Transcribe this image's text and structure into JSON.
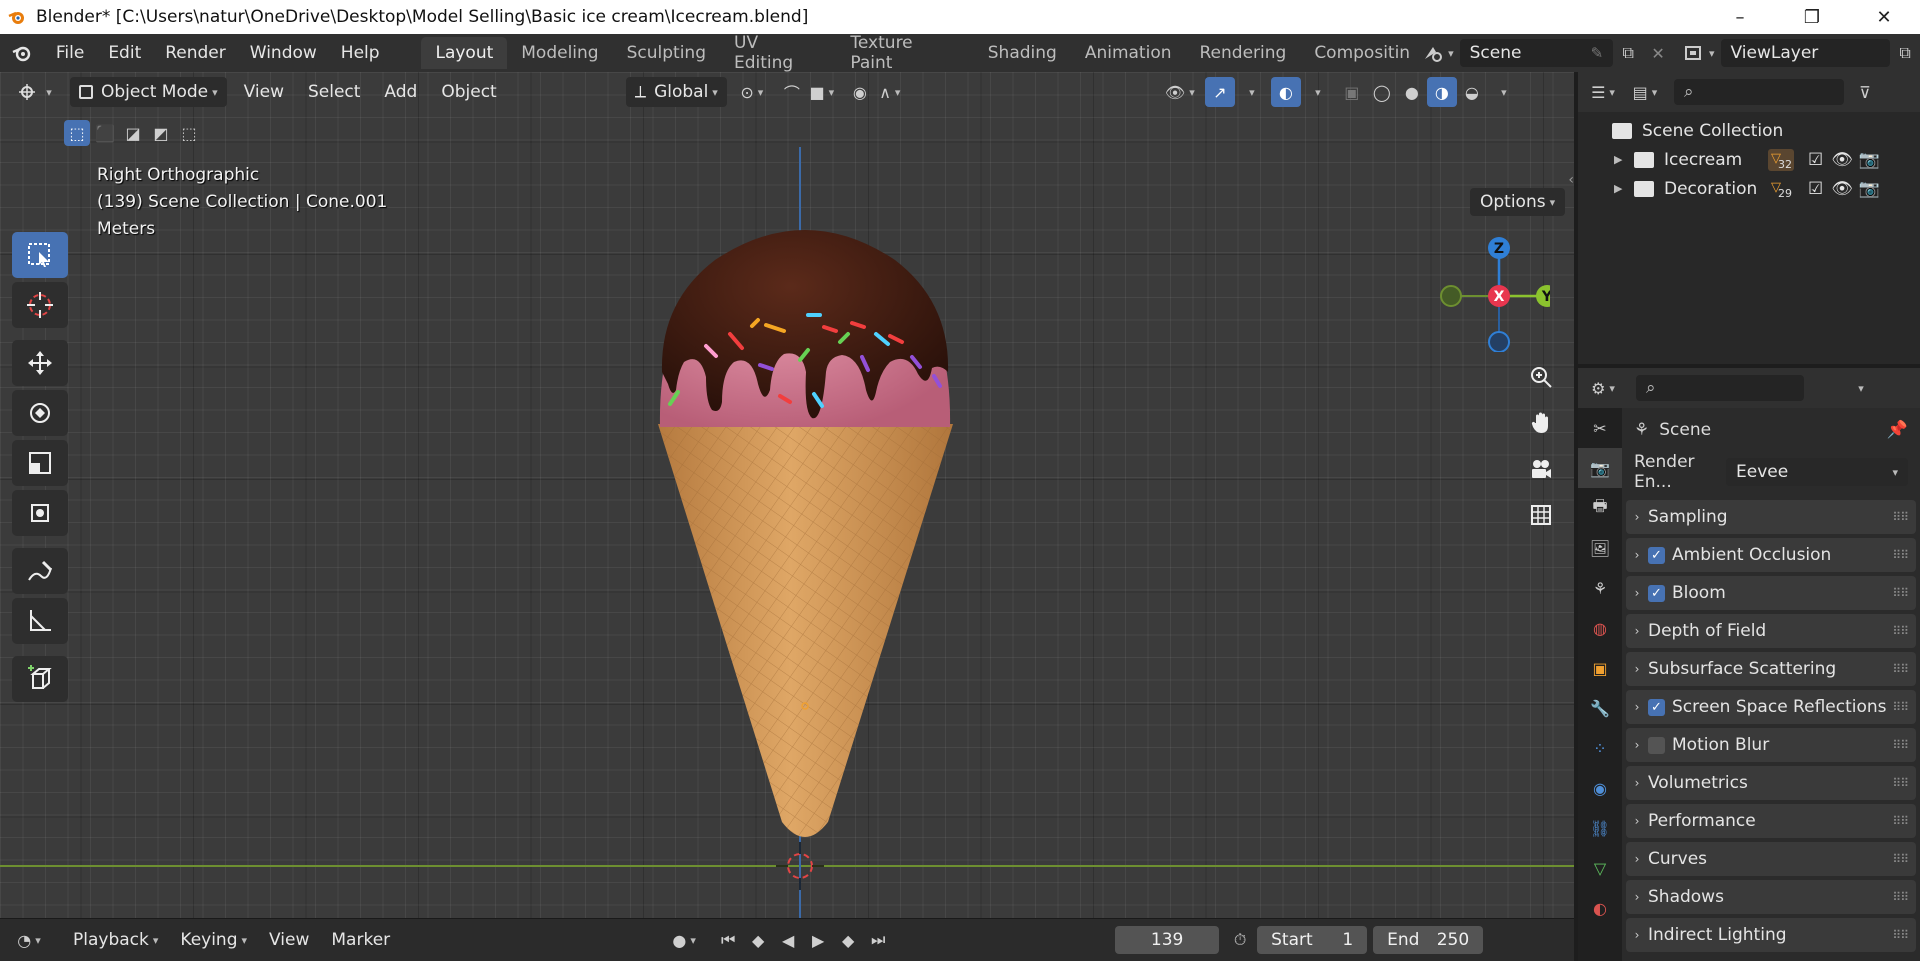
{
  "window": {
    "title": "Blender* [C:\\Users\\natur\\OneDrive\\Desktop\\Model Selling\\Basic ice cream\\Icecream.blend]",
    "minimize": "–",
    "restore": "❐",
    "close": "✕"
  },
  "menu": [
    "File",
    "Edit",
    "Render",
    "Window",
    "Help"
  ],
  "workspaces": [
    {
      "label": "Layout",
      "active": true
    },
    {
      "label": "Modeling"
    },
    {
      "label": "Sculpting"
    },
    {
      "label": "UV Editing"
    },
    {
      "label": "Texture Paint"
    },
    {
      "label": "Shading"
    },
    {
      "label": "Animation"
    },
    {
      "label": "Rendering"
    },
    {
      "label": "Compositin"
    }
  ],
  "scene_field": "Scene",
  "viewlayer_field": "ViewLayer",
  "viewport": {
    "mode": "Object Mode",
    "menus": [
      "View",
      "Select",
      "Add",
      "Object"
    ],
    "transform_orientation": "Global",
    "options_label": "Options",
    "info_view": "Right Orthographic",
    "info_collection": "(139) Scene Collection | Cone.001",
    "info_units": "Meters",
    "gizmo_axes": {
      "z": "Z",
      "x": "X",
      "y": "Y"
    }
  },
  "timeline": {
    "playback": "Playback",
    "keying": "Keying",
    "view": "View",
    "marker": "Marker",
    "current_frame": "139",
    "start_label": "Start",
    "start_value": "1",
    "end_label": "End",
    "end_value": "250"
  },
  "outliner": {
    "root": "Scene Collection",
    "collections": [
      {
        "name": "Icecream",
        "count": "32"
      },
      {
        "name": "Decoration",
        "count": "29"
      }
    ]
  },
  "properties": {
    "context": "Scene",
    "render_engine_label": "Render En...",
    "render_engine_value": "Eevee",
    "panels": [
      {
        "label": "Sampling",
        "checkbox": null
      },
      {
        "label": "Ambient Occlusion",
        "checkbox": true
      },
      {
        "label": "Bloom",
        "checkbox": true
      },
      {
        "label": "Depth of Field",
        "checkbox": null
      },
      {
        "label": "Subsurface Scattering",
        "checkbox": null
      },
      {
        "label": "Screen Space Reflections",
        "checkbox": true
      },
      {
        "label": "Motion Blur",
        "checkbox": false
      },
      {
        "label": "Volumetrics",
        "checkbox": null
      },
      {
        "label": "Performance",
        "checkbox": null
      },
      {
        "label": "Curves",
        "checkbox": null
      },
      {
        "label": "Shadows",
        "checkbox": null
      },
      {
        "label": "Indirect Lighting",
        "checkbox": null
      }
    ]
  },
  "colors": {
    "accent": "#4772b3",
    "axis_x": "#e8364f",
    "axis_y": "#8bc22e",
    "axis_z": "#2f7fd6",
    "ice_cream": "#d87c93",
    "chocolate": "#3a1b12",
    "cone": "#d39a5a"
  }
}
